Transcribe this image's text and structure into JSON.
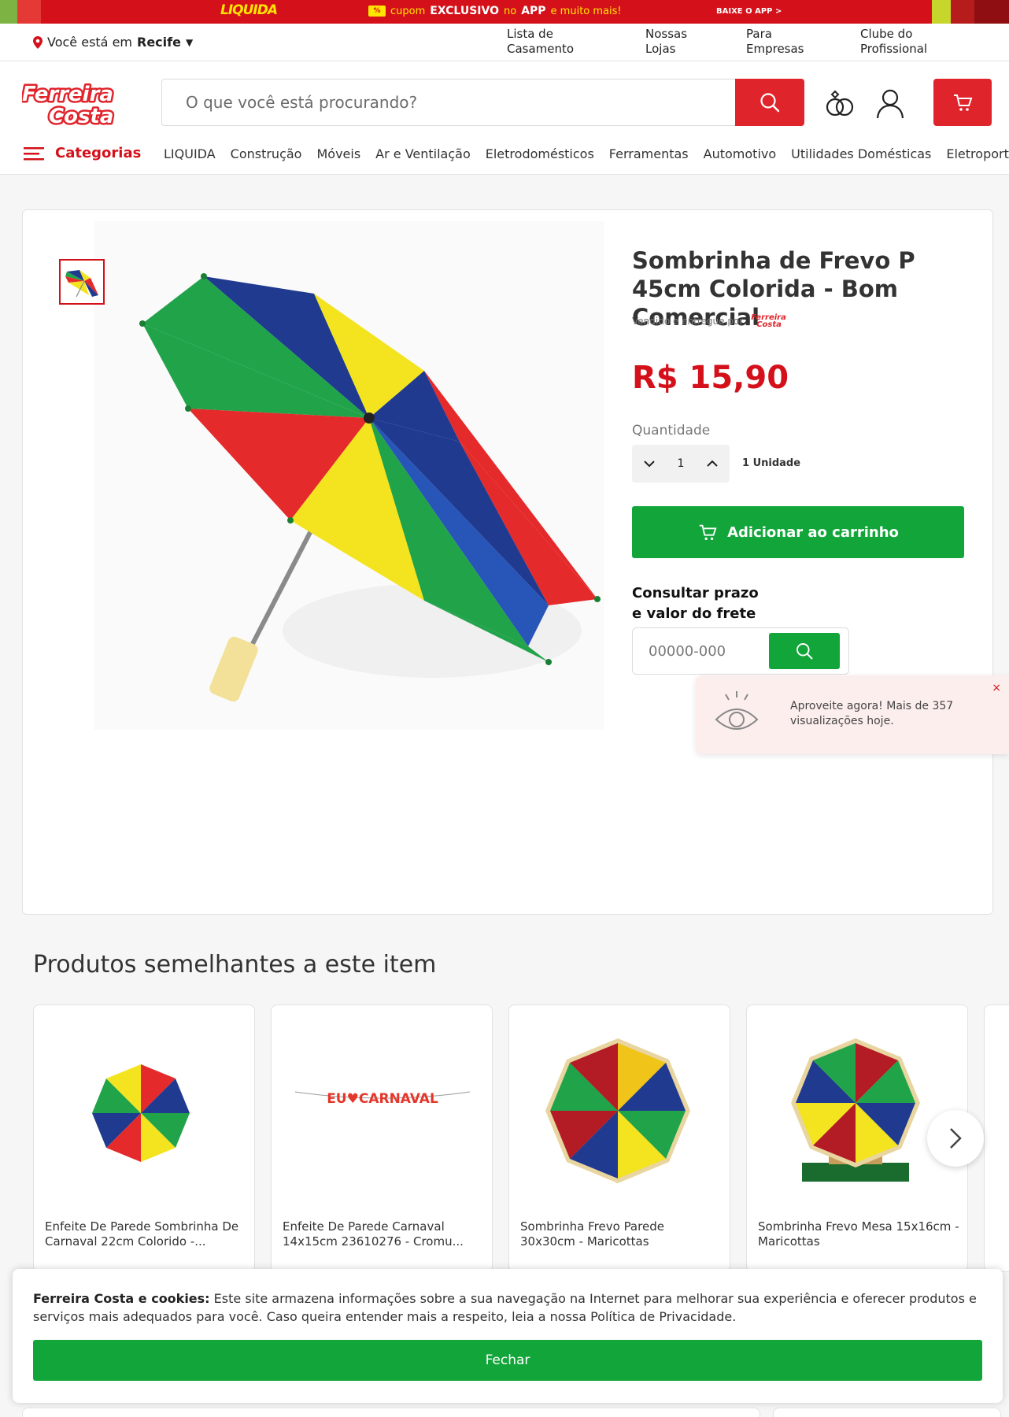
{
  "promo": {
    "liquida": "LIQUIDA",
    "coupon_prefix": "cupom",
    "coupon_strong": "EXCLUSIVO",
    "coupon_mid": "no",
    "coupon_app": "APP",
    "coupon_suffix": "e muito mais!",
    "app_cta": "BAIXE O APP  >"
  },
  "utility": {
    "location_prefix": "Você está em",
    "location_city": "Recife",
    "links": [
      {
        "line1": "Lista de",
        "line2": "Casamento"
      },
      {
        "line1": "Nossas",
        "line2": "Lojas"
      },
      {
        "line1": "Para",
        "line2": "Empresas"
      },
      {
        "line1": "Clube do",
        "line2": "Profissional"
      }
    ]
  },
  "header": {
    "logo_line1": "Ferreira",
    "logo_line2": "Costa",
    "search_placeholder": "O que você está procurando?"
  },
  "nav": {
    "categories_label": "Categorias",
    "items": [
      "LIQUIDA",
      "Construção",
      "Móveis",
      "Ar e Ventilação",
      "Eletrodomésticos",
      "Ferramentas",
      "Automotivo",
      "Utilidades Domésticas",
      "Eletroportáteis"
    ]
  },
  "product": {
    "title": "Sombrinha de Frevo P 45cm Colorida - Bom Comercial",
    "sold_by": "Vendido e entregue por",
    "price": "R$ 15,90",
    "quantity_label": "Quantidade",
    "quantity_value": "1",
    "quantity_unit": "1 Unidade",
    "add_to_cart": "Adicionar ao carrinho",
    "shipping_line1": "Consultar prazo",
    "shipping_line2": "e valor do frete",
    "cep_placeholder": "00000-000"
  },
  "toast": {
    "message": "Aproveite agora! Mais de 357 visualizações hoje.",
    "close": "×"
  },
  "similar": {
    "title": "Produtos semelhantes a este item",
    "items": [
      {
        "name": "Enfeite De Parede Sombrinha De Carnaval 22cm Colorido -..."
      },
      {
        "name": "Enfeite De Parede Carnaval 14x15cm 23610276 - Cromu...",
        "banner": "EU♥CARNAVAL"
      },
      {
        "name": "Sombrinha Frevo Parede 30x30cm - Maricottas"
      },
      {
        "name": "Sombrinha Frevo Mesa 15x16cm - Maricottas"
      }
    ]
  },
  "cookies": {
    "title": "Ferreira Costa e cookies:",
    "text": "Este site armazena informações sobre a sua navegação na Internet para melhorar sua experiência e oferecer produtos e serviços mais adequados para você. Caso queira entender mais a respeito, leia a nossa Política de Privacidade.",
    "button": "Fechar"
  },
  "colors": {
    "brand_red": "#d4111a",
    "green": "#12a63a"
  }
}
